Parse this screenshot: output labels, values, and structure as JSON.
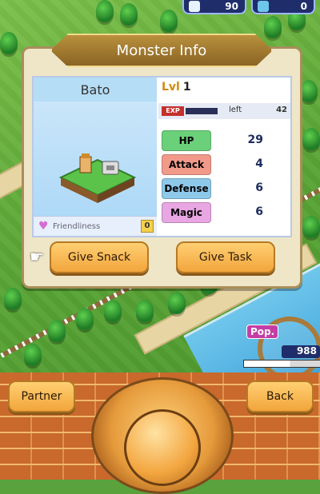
{
  "hud": {
    "left_counter": "90",
    "right_counter": "0"
  },
  "panel": {
    "title": "Monster Info"
  },
  "monster": {
    "name": "Bato",
    "friendliness_label": "Friendliness",
    "friendliness_value": "0",
    "level_label": "Lvl",
    "level": "1",
    "exp_label": "EXP",
    "exp_left_label": "left",
    "exp_left": "42",
    "stats": [
      {
        "label": "HP",
        "value": "29",
        "color": "#6bd07a"
      },
      {
        "label": "Attack",
        "value": "4",
        "color": "#f29a8a"
      },
      {
        "label": "Defense",
        "value": "6",
        "color": "#8ec9ea"
      },
      {
        "label": "Magic",
        "value": "6",
        "color": "#e8a6e2"
      }
    ]
  },
  "actions": {
    "give_snack": "Give Snack",
    "give_task": "Give Task"
  },
  "bottom": {
    "partner": "Partner",
    "back": "Back"
  },
  "population": {
    "label": "Pop.",
    "value": "988",
    "bar_fraction": 0.6
  },
  "colors": {
    "button": "#f2a53c",
    "hud": "#1f2e6b",
    "grass": "#5aa23c"
  }
}
